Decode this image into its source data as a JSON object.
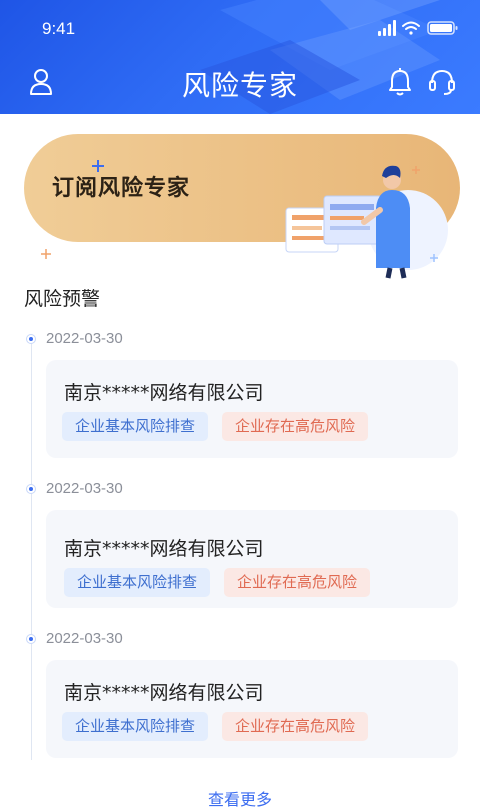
{
  "status": {
    "time": "9:41"
  },
  "header": {
    "title": "风险专家"
  },
  "banner": {
    "title": "订阅风险专家"
  },
  "section": {
    "title": "风险预警"
  },
  "alerts": [
    {
      "date": "2022-03-30",
      "company": "南京*****网络有限公司",
      "tags": [
        "企业基本风险排查",
        "企业存在高危风险"
      ]
    },
    {
      "date": "2022-03-30",
      "company": "南京*****网络有限公司",
      "tags": [
        "企业基本风险排查",
        "企业存在高危风险"
      ]
    },
    {
      "date": "2022-03-30",
      "company": "南京*****网络有限公司",
      "tags": [
        "企业基本风险排查",
        "企业存在高危风险"
      ]
    }
  ],
  "more": {
    "label": "查看更多"
  },
  "icons": {
    "left": "user-icon",
    "bell": "bell-icon",
    "support": "headset-icon"
  },
  "colors": {
    "primary": "#2f6cf5",
    "banner": "#ecc184",
    "tag_blue": "#3e6fcf",
    "tag_red": "#e06a52"
  }
}
